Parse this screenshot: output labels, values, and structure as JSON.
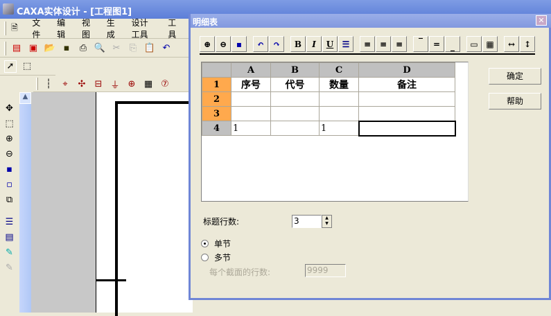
{
  "app": {
    "title": "CAXA实体设计 - [工程图1]"
  },
  "menu": [
    "文件",
    "编辑",
    "视图",
    "生成",
    "设计工具",
    "工具"
  ],
  "dialog": {
    "title": "明细表",
    "toolbar": [
      "zoom-in",
      "zoom-out",
      "fit",
      "undo",
      "redo",
      "B",
      "I",
      "U",
      "line-style",
      "align-left",
      "align-center",
      "align-right",
      "valign-top",
      "valign-middle",
      "valign-bottom",
      "border",
      "grid",
      "col-width",
      "row-height"
    ],
    "columns": [
      "A",
      "B",
      "C",
      "D"
    ],
    "rows": [
      {
        "label": "1",
        "cells": [
          "序号",
          "代号",
          "数量",
          "备注"
        ]
      },
      {
        "label": "2",
        "cells": [
          "",
          "",
          "",
          ""
        ]
      },
      {
        "label": "3",
        "cells": [
          "",
          "",
          "",
          ""
        ]
      },
      {
        "label": "4",
        "cells": [
          "1",
          "",
          "1",
          ""
        ]
      }
    ],
    "ok_label": "确定",
    "help_label": "帮助",
    "header_rows_label": "标题行数:",
    "header_rows_value": "3",
    "single_label": "单节",
    "multi_label": "多节",
    "rows_per_section_label": "每个截面的行数:",
    "rows_per_section_value": "9999",
    "selected_mode": "single"
  },
  "colors": {
    "row_header": "#FFA94D",
    "title_blue": "#5C7ED8"
  }
}
